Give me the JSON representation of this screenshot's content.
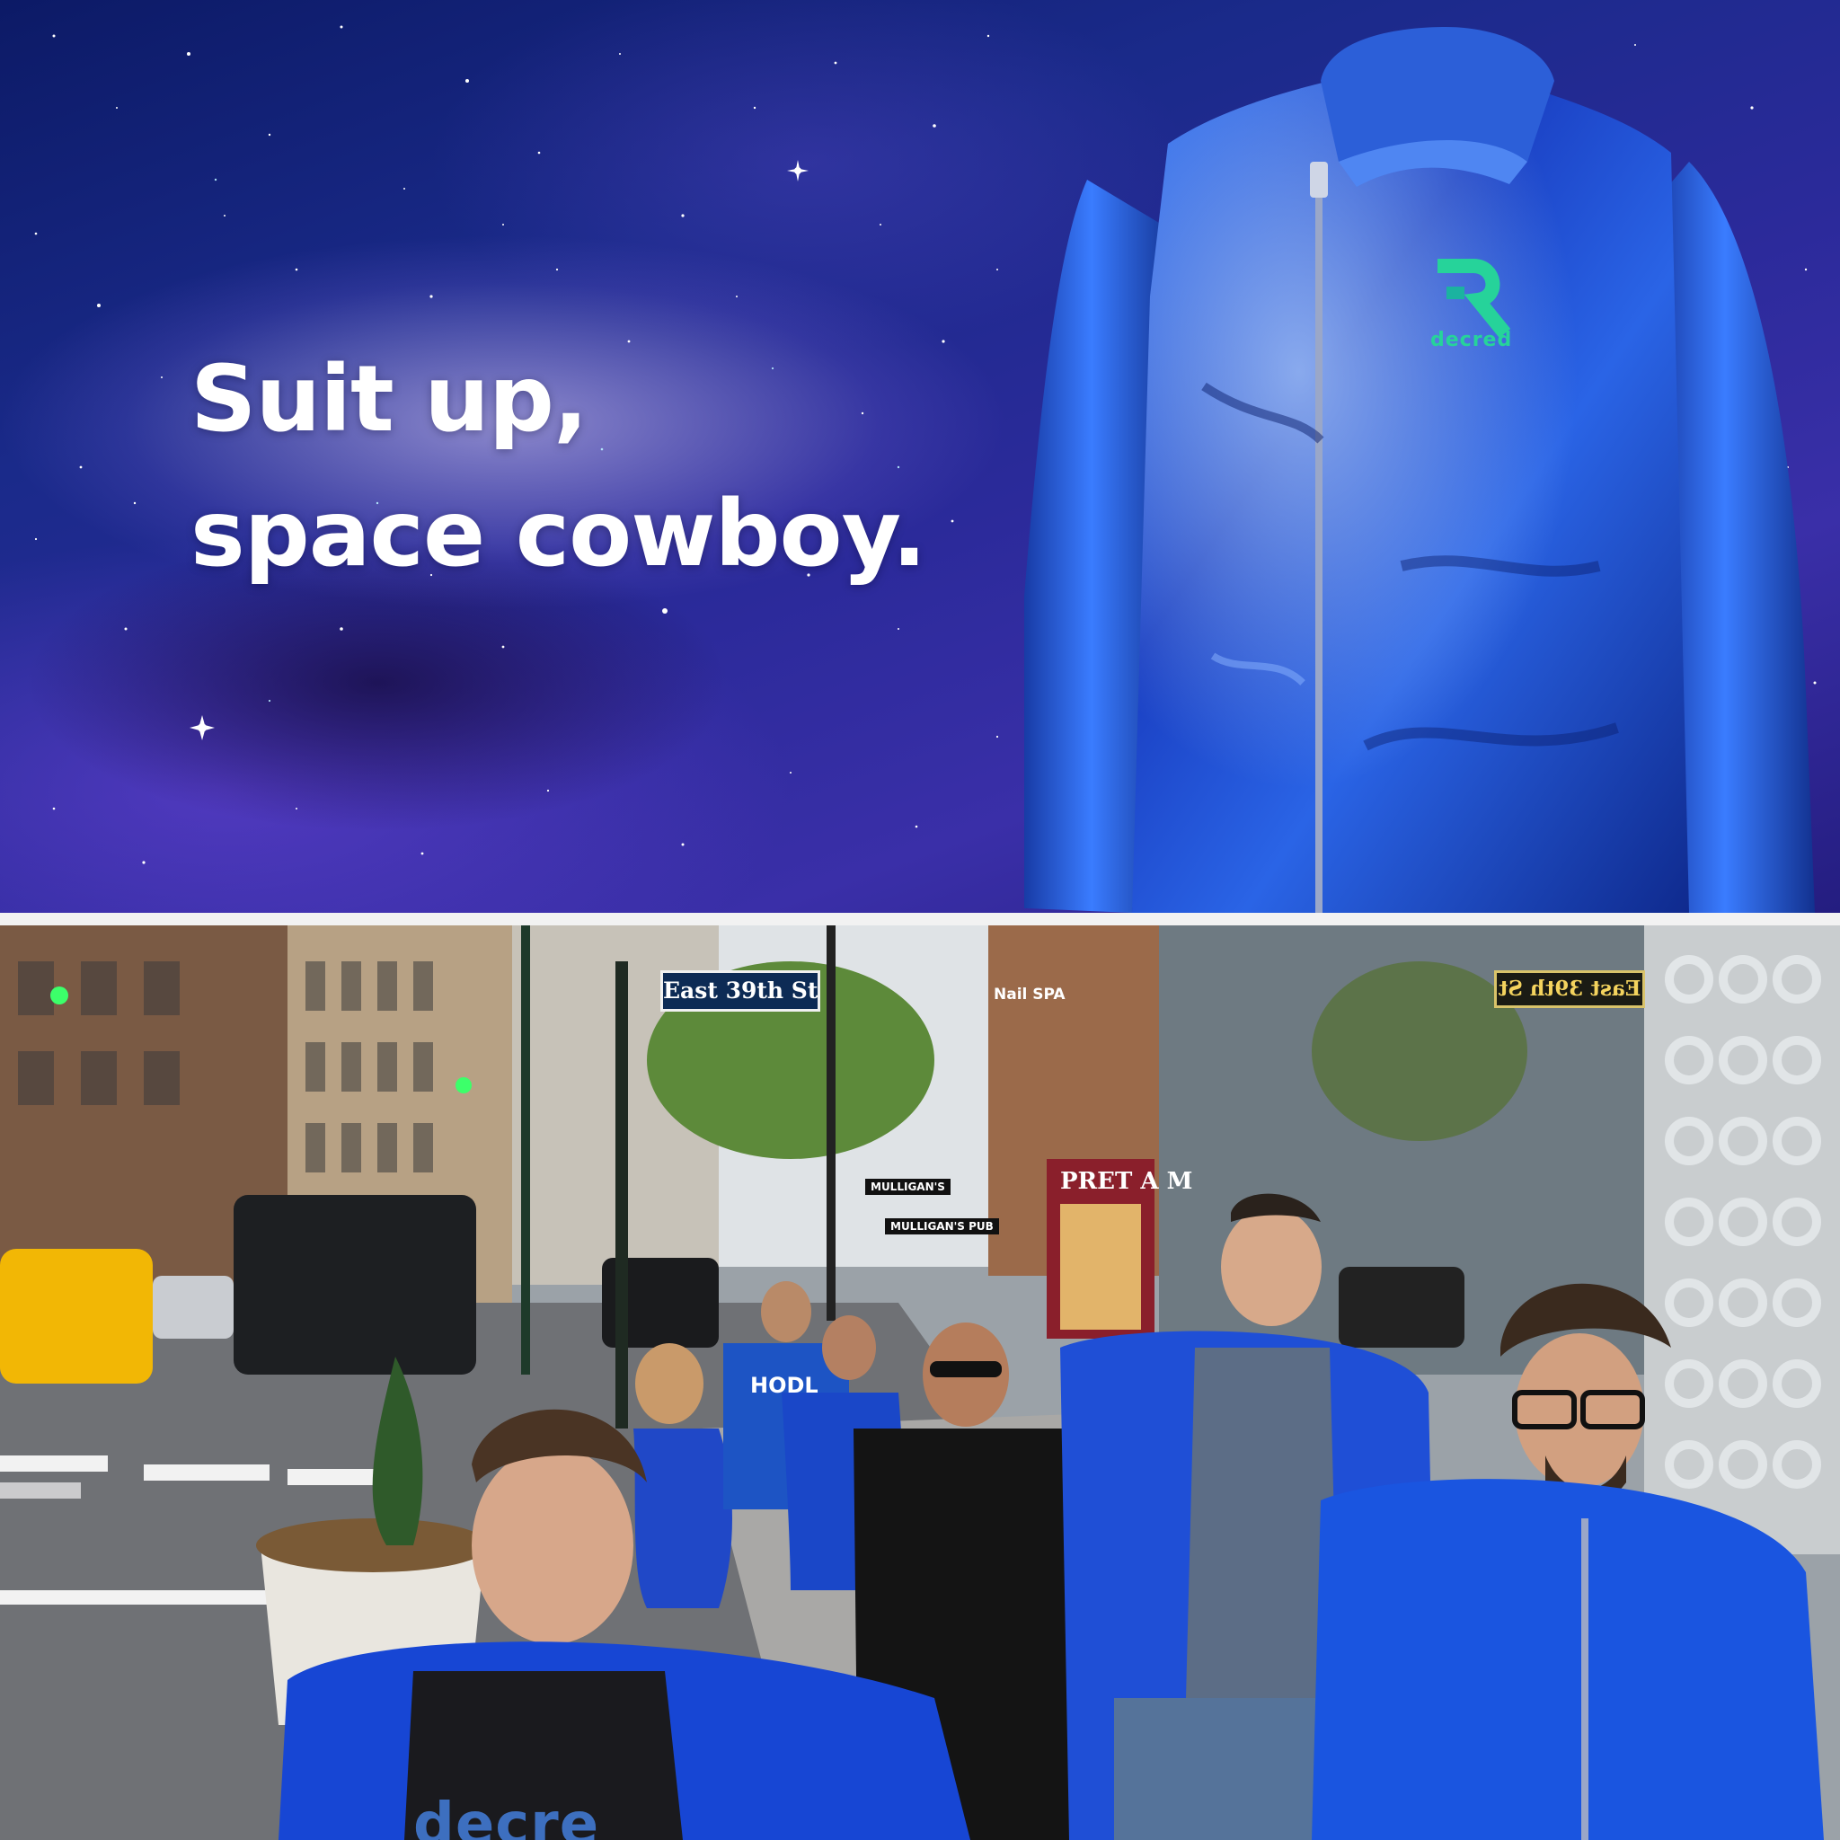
{
  "banner": {
    "headline_line1": "Suit up,",
    "headline_line2": "space cowboy.",
    "jacket_logo_text": "decred",
    "colors": {
      "space_dark": "#0c1a66",
      "nebula": "#3a2fa8",
      "jacket": "#1f4fd6",
      "logo_green": "#26d39a"
    }
  },
  "photo": {
    "street_sign": "East 39th St",
    "street_sign_mirrored": "East 39th St",
    "store_sign_pret": "PRET A M",
    "pub_sign_1": "MULLIGAN'S",
    "pub_sign_2": "MULLIGAN'S PUB",
    "nail_sign": "Nail SPA",
    "shirt_hodl": "HODL",
    "shirt_logo_text": "decre"
  }
}
